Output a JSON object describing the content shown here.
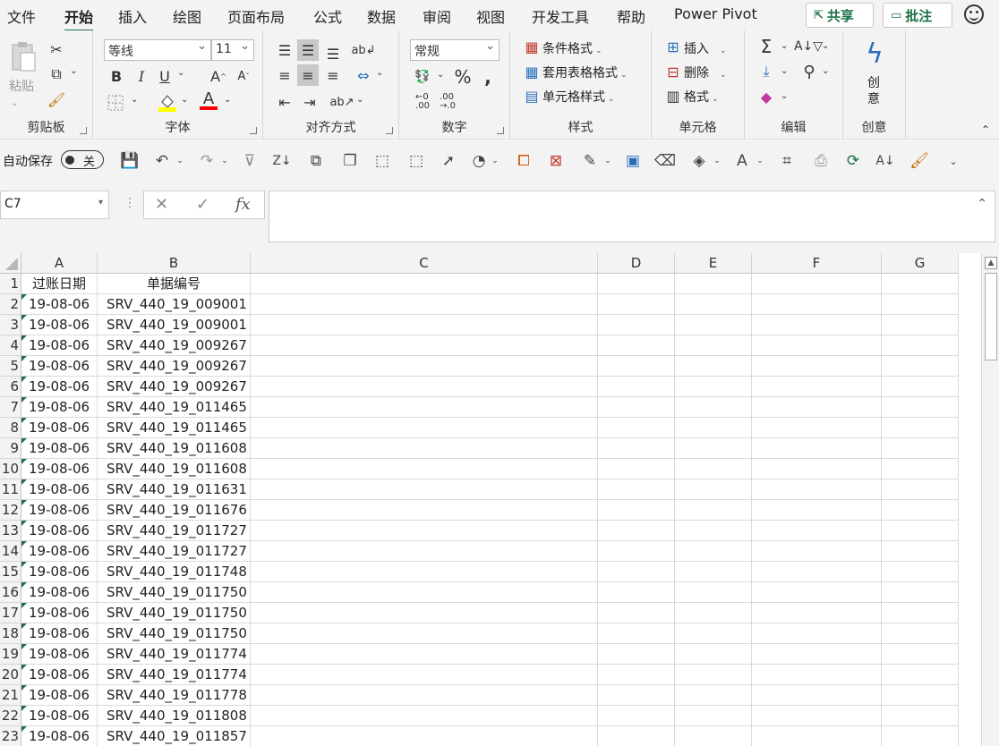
{
  "menu": {
    "tabs": [
      "文件",
      "开始",
      "插入",
      "绘图",
      "页面布局",
      "公式",
      "数据",
      "审阅",
      "视图",
      "开发工具",
      "帮助",
      "Power Pivot"
    ],
    "active": "开始",
    "share_label": "共享",
    "comment_label": "批注"
  },
  "ribbon": {
    "clipboard": {
      "paste_label": "粘贴",
      "group_label": "剪贴板"
    },
    "font": {
      "font_name": "等线",
      "font_size": "11",
      "group_label": "字体",
      "highlight_color": "#ffff00",
      "font_color": "#ff0000"
    },
    "alignment": {
      "group_label": "对齐方式"
    },
    "number": {
      "format": "常规",
      "group_label": "数字"
    },
    "styles": {
      "conditional": "条件格式",
      "table_format": "套用表格格式",
      "cell_style": "单元格样式",
      "group_label": "样式"
    },
    "cells": {
      "insert": "插入",
      "delete": "删除",
      "format": "格式",
      "group_label": "单元格"
    },
    "editing": {
      "group_label": "编辑"
    },
    "ideas": {
      "label": "创意",
      "group_label": "创意"
    }
  },
  "qat": {
    "autosave_label": "自动保存",
    "autosave_state": "关"
  },
  "formula_bar": {
    "name_box": "C7",
    "formula": ""
  },
  "sheet": {
    "columns": [
      "A",
      "B",
      "C",
      "D",
      "E",
      "F",
      "G"
    ],
    "header_row": [
      "过账日期",
      "单据编号"
    ],
    "rows": [
      [
        "19-08-06",
        "SRV_440_19_009001"
      ],
      [
        "19-08-06",
        "SRV_440_19_009001"
      ],
      [
        "19-08-06",
        "SRV_440_19_009267"
      ],
      [
        "19-08-06",
        "SRV_440_19_009267"
      ],
      [
        "19-08-06",
        "SRV_440_19_009267"
      ],
      [
        "19-08-06",
        "SRV_440_19_011465"
      ],
      [
        "19-08-06",
        "SRV_440_19_011465"
      ],
      [
        "19-08-06",
        "SRV_440_19_011608"
      ],
      [
        "19-08-06",
        "SRV_440_19_011608"
      ],
      [
        "19-08-06",
        "SRV_440_19_011631"
      ],
      [
        "19-08-06",
        "SRV_440_19_011676"
      ],
      [
        "19-08-06",
        "SRV_440_19_011727"
      ],
      [
        "19-08-06",
        "SRV_440_19_011727"
      ],
      [
        "19-08-06",
        "SRV_440_19_011748"
      ],
      [
        "19-08-06",
        "SRV_440_19_011750"
      ],
      [
        "19-08-06",
        "SRV_440_19_011750"
      ],
      [
        "19-08-06",
        "SRV_440_19_011750"
      ],
      [
        "19-08-06",
        "SRV_440_19_011774"
      ],
      [
        "19-08-06",
        "SRV_440_19_011774"
      ],
      [
        "19-08-06",
        "SRV_440_19_011778"
      ],
      [
        "19-08-06",
        "SRV_440_19_011808"
      ],
      [
        "19-08-06",
        "SRV_440_19_011857"
      ]
    ]
  }
}
